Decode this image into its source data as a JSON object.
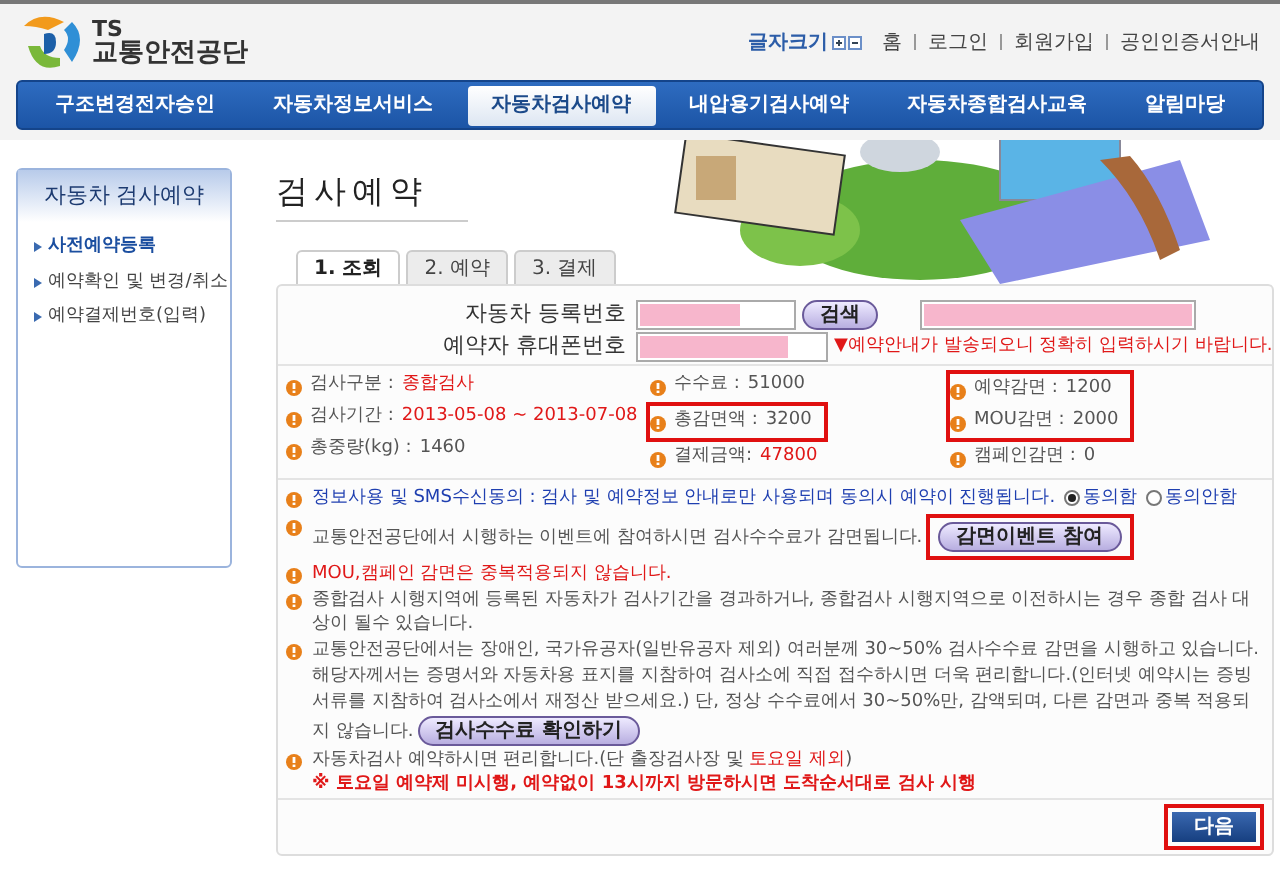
{
  "header": {
    "logo_top": "TS",
    "logo_name": "교통안전공단",
    "font_size_label": "글자크기",
    "links": [
      "홈",
      "로그인",
      "회원가입",
      "공인인증서안내"
    ]
  },
  "nav": [
    {
      "label": "구조변경전자승인",
      "selected": false
    },
    {
      "label": "자동차정보서비스",
      "selected": false
    },
    {
      "label": "자동차검사예약",
      "selected": true
    },
    {
      "label": "내압용기검사예약",
      "selected": false
    },
    {
      "label": "자동차종합검사교육",
      "selected": false
    },
    {
      "label": "알림마당",
      "selected": false
    }
  ],
  "sidebar": {
    "title": "자동차 검사예약",
    "items": [
      {
        "label": "사전예약등록",
        "selected": true
      },
      {
        "label": "예약확인 및 변경/취소",
        "selected": false
      },
      {
        "label": "예약결제번호(입력)",
        "selected": false
      }
    ]
  },
  "page_title": "검사예약",
  "tabs": [
    {
      "label": "1. 조회",
      "selected": true
    },
    {
      "label": "2. 예약",
      "selected": false
    },
    {
      "label": "3. 결제",
      "selected": false
    }
  ],
  "form": {
    "vehicle_label": "자동차 등록번호",
    "vehicle_redacted": true,
    "search_button": "검색",
    "owner_redacted": true,
    "phone_label": "예약자 휴대폰번호",
    "phone_redacted": true,
    "phone_note": "▼예약안내가 발송되오니 정확히 입력하시기 바랍니다."
  },
  "info_columns": [
    [
      {
        "label": "검사구분 :",
        "value": "종합검사",
        "emphasis": true,
        "boxed": false
      },
      {
        "label": "검사기간 :",
        "value": "2013-05-08 ~ 2013-07-08",
        "emphasis": true,
        "boxed": false
      },
      {
        "label": "총중량(kg) :",
        "value": "1460",
        "emphasis": false,
        "boxed": false
      }
    ],
    [
      {
        "label": "수수료 :",
        "value": "51000",
        "emphasis": false,
        "boxed": false
      },
      {
        "label": "총감면액 :",
        "value": "3200",
        "emphasis": false,
        "boxed": true
      },
      {
        "label": "결제금액:",
        "value": "47800",
        "emphasis": true,
        "boxed": false
      }
    ],
    [
      {
        "label": "예약감면 :",
        "value": "1200",
        "emphasis": false,
        "boxed": true
      },
      {
        "label": "MOU감면 :",
        "value": "2000",
        "emphasis": false,
        "boxed": true
      },
      {
        "label": "캠페인감면 :",
        "value": "0",
        "emphasis": false,
        "boxed": false
      }
    ]
  ],
  "notices": [
    {
      "kind": "consent",
      "color": "#1f3fb0",
      "text": "정보사용 및 SMS수신동의 : 검사 및 예약정보 안내로만 사용되며 동의시 예약이 진행됩니다.",
      "options": [
        {
          "label": "동의함",
          "selected": true
        },
        {
          "label": "동의안함",
          "selected": false
        }
      ]
    },
    {
      "kind": "button",
      "color": "#555555",
      "text": "교통안전공단에서 시행하는 이벤트에 참여하시면 검사수수료가 감면됩니다.",
      "button": "감면이벤트 참여",
      "boxed": true
    },
    {
      "kind": "plain",
      "color": "#e01818",
      "text": "MOU,캠페인 감면은 중복적용되지 않습니다."
    },
    {
      "kind": "plain",
      "color": "#555555",
      "text": "종합검사 시행지역에 등록된 자동차가 검사기간을 경과하거나, 종합검사 시행지역으로 이전하시는 경우 종합 검사 대상이 될수 있습니다."
    },
    {
      "kind": "button",
      "color": "#555555",
      "text": "교통안전공단에서는 장애인, 국가유공자(일반유공자 제외) 여러분께 30~50% 검사수수료 감면을 시행하고 있습니다. 해당자께서는 증명서와 자동차용 표지를 지참하여 검사소에 직접 접수하시면 더욱 편리합니다.(인터넷 예약시는 증빙서류를 지참하여 검사소에서 재정산 받으세요.) 단, 정상 수수료에서 30~50%만, 감액되며, 다른 감면과 중복 적용되지 않습니다.",
      "button": "검사수수료 확인하기",
      "boxed": false
    },
    {
      "kind": "split",
      "color": "#555555",
      "text": "자동차검사 예약하시면 편리합니다.(단 출장검사장 및 ",
      "red_text": "토요일 제외",
      "tail": ")",
      "note": "※ 토요일 예약제 미시행, 예약없이 13시까지 방문하시면 도착순서대로 검사 시행"
    }
  ],
  "next_button": {
    "label": "다음",
    "boxed": true
  }
}
